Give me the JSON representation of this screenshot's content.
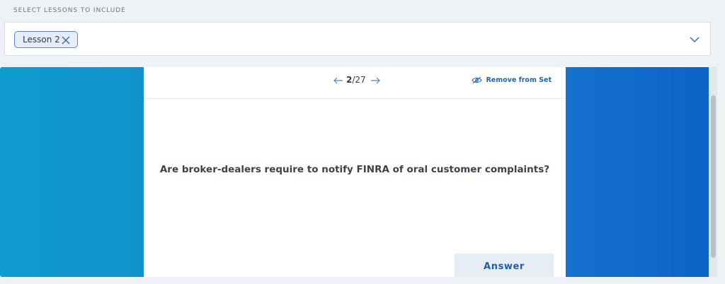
{
  "filter": {
    "section_label": "SELECT LESSONS TO INCLUDE",
    "selected_lessons": [
      "Lesson 2"
    ]
  },
  "flashcard": {
    "current": "2",
    "total": "/27",
    "remove_label": "Remove from Set",
    "question": "Are broker-dealers require to notify FINRA of oral customer complaints?",
    "answer_label": "Answer"
  },
  "icons": {
    "chip_remove": "close-icon",
    "dropdown": "chevron-down-icon",
    "prev": "arrow-left-icon",
    "next": "arrow-right-icon",
    "remove_set": "eye-slash-icon"
  },
  "colors": {
    "accent": "#1e63b5",
    "stage_left": "#0e9bcd",
    "stage_right": "#0b63c6",
    "chip_border": "#5f86b8"
  }
}
